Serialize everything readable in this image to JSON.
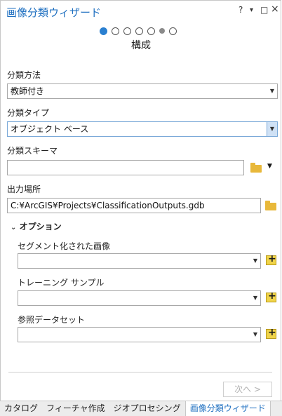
{
  "title": "画像分類ウィザード",
  "window_controls": {
    "help": "?",
    "menu": "▾",
    "restore": "□",
    "close": "×"
  },
  "step_name": "構成",
  "fields": {
    "method": {
      "label": "分類方法",
      "value": "教師付き"
    },
    "type": {
      "label": "分類タイプ",
      "value": "オブジェクト ベース"
    },
    "schema": {
      "label": "分類スキーマ",
      "value": ""
    },
    "output": {
      "label": "出力場所",
      "value": "C:¥ArcGIS¥Projects¥ClassificationOutputs.gdb"
    }
  },
  "options": {
    "header": "オプション",
    "segmented": {
      "label": "セグメント化された画像",
      "value": ""
    },
    "training": {
      "label": "トレーニング サンプル",
      "value": ""
    },
    "reference": {
      "label": "参照データセット",
      "value": ""
    }
  },
  "next_button": "次へ >",
  "tabs": [
    "カタログ",
    "フィーチャ作成",
    "ジオプロセシング",
    "画像分類ウィザード"
  ],
  "icons": {
    "folder": "folder-open-icon",
    "add": "add-data-icon",
    "caret": "chevron-down-icon"
  }
}
